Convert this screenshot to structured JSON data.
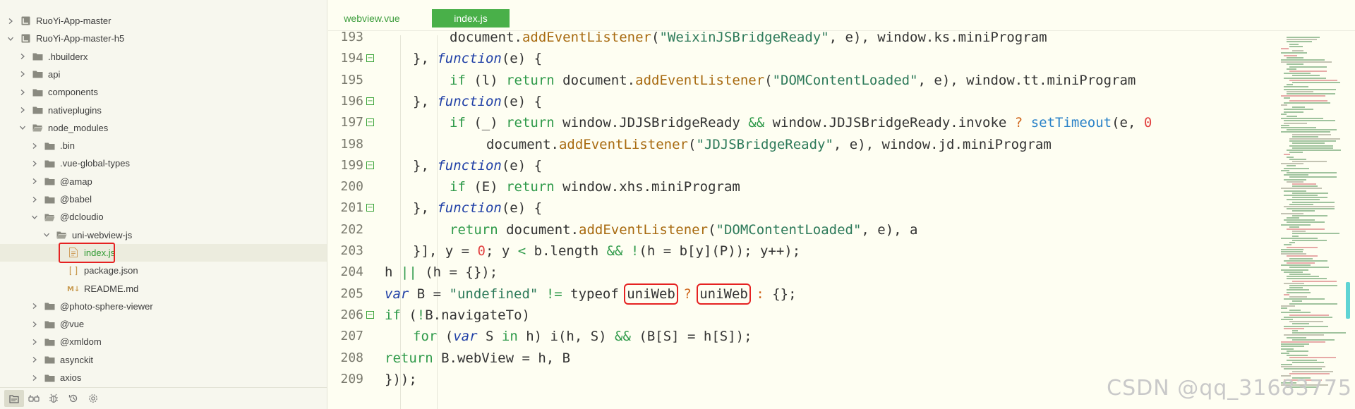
{
  "explorer": {
    "items": [
      {
        "label": "RuoYi-App-master",
        "depth": 0,
        "expanded": false,
        "type": "project"
      },
      {
        "label": "RuoYi-App-master-h5",
        "depth": 0,
        "expanded": true,
        "type": "project"
      },
      {
        "label": ".hbuilderx",
        "depth": 1,
        "expanded": false,
        "type": "folder"
      },
      {
        "label": "api",
        "depth": 1,
        "expanded": false,
        "type": "folder"
      },
      {
        "label": "components",
        "depth": 1,
        "expanded": false,
        "type": "folder"
      },
      {
        "label": "nativeplugins",
        "depth": 1,
        "expanded": false,
        "type": "folder"
      },
      {
        "label": "node_modules",
        "depth": 1,
        "expanded": true,
        "type": "folder"
      },
      {
        "label": ".bin",
        "depth": 2,
        "expanded": false,
        "type": "folder"
      },
      {
        "label": ".vue-global-types",
        "depth": 2,
        "expanded": false,
        "type": "folder"
      },
      {
        "label": "@amap",
        "depth": 2,
        "expanded": false,
        "type": "folder"
      },
      {
        "label": "@babel",
        "depth": 2,
        "expanded": false,
        "type": "folder"
      },
      {
        "label": "@dcloudio",
        "depth": 2,
        "expanded": true,
        "type": "folder"
      },
      {
        "label": "uni-webview-js",
        "depth": 3,
        "expanded": true,
        "type": "folder"
      },
      {
        "label": "index.js",
        "depth": 4,
        "type": "js-file",
        "selected": true
      },
      {
        "label": "package.json",
        "depth": 4,
        "type": "json-file"
      },
      {
        "label": "README.md",
        "depth": 4,
        "type": "md-file"
      },
      {
        "label": "@photo-sphere-viewer",
        "depth": 2,
        "expanded": false,
        "type": "folder"
      },
      {
        "label": "@vue",
        "depth": 2,
        "expanded": false,
        "type": "folder"
      },
      {
        "label": "@xmldom",
        "depth": 2,
        "expanded": false,
        "type": "folder"
      },
      {
        "label": "asynckit",
        "depth": 2,
        "expanded": false,
        "type": "folder"
      },
      {
        "label": "axios",
        "depth": 2,
        "expanded": false,
        "type": "folder"
      }
    ]
  },
  "toolbar": {
    "icons": [
      "project-manager-icon",
      "plugin-icon",
      "bug-icon",
      "history-icon",
      "settings-icon"
    ]
  },
  "tabs": [
    {
      "label": "webview.vue",
      "active": false
    },
    {
      "label": "index.js",
      "active": true
    }
  ],
  "code": {
    "lines": [
      {
        "num": "193",
        "fold": false,
        "indent": 2
      },
      {
        "num": "194",
        "fold": true,
        "indent": 1
      },
      {
        "num": "195",
        "fold": false,
        "indent": 2
      },
      {
        "num": "196",
        "fold": true,
        "indent": 1
      },
      {
        "num": "197",
        "fold": true,
        "indent": 2
      },
      {
        "num": "198",
        "fold": false,
        "indent": 3
      },
      {
        "num": "199",
        "fold": true,
        "indent": 1
      },
      {
        "num": "200",
        "fold": false,
        "indent": 2
      },
      {
        "num": "201",
        "fold": true,
        "indent": 1
      },
      {
        "num": "202",
        "fold": false,
        "indent": 2
      },
      {
        "num": "203",
        "fold": false,
        "indent": 1
      },
      {
        "num": "204",
        "fold": false,
        "indent": 0
      },
      {
        "num": "205",
        "fold": false,
        "indent": 0
      },
      {
        "num": "206",
        "fold": true,
        "indent": 0
      },
      {
        "num": "207",
        "fold": false,
        "indent": 1
      },
      {
        "num": "208",
        "fold": false,
        "indent": 0
      },
      {
        "num": "209",
        "fold": false,
        "indent": 0
      }
    ],
    "tokens": {
      "l193": [
        "document.",
        "addEventListener",
        "(",
        "\"WeixinJSBridgeReady\"",
        ", e), window.ks.miniProgram"
      ],
      "l194": [
        "}, ",
        "function",
        "(e) {"
      ],
      "l195": [
        "if",
        " (l) ",
        "return",
        " document.",
        "addEventListener",
        "(",
        "\"DOMContentLoaded\"",
        ", e), window.tt.miniProgram"
      ],
      "l196": [
        "}, ",
        "function",
        "(e) {"
      ],
      "l197": [
        "if",
        " (_) ",
        "return",
        " window.JDJSBridgeReady ",
        "&&",
        " window.JDJSBridgeReady.invoke ",
        "?",
        " ",
        "setTimeout",
        "(e, ",
        "0"
      ],
      "l198": [
        "document.",
        "addEventListener",
        "(",
        "\"JDJSBridgeReady\"",
        ", e), window.jd.miniProgram"
      ],
      "l199": [
        "}, ",
        "function",
        "(e) {"
      ],
      "l200": [
        "if",
        " (E) ",
        "return",
        " window.xhs.miniProgram"
      ],
      "l201": [
        "}, ",
        "function",
        "(e) {"
      ],
      "l202": [
        "return",
        " document.",
        "addEventListener",
        "(",
        "\"DOMContentLoaded\"",
        ", e), a"
      ],
      "l203": [
        "}], y = ",
        "0",
        "; y ",
        "<",
        " b.length ",
        "&&",
        " ",
        "!",
        "(h = b[y](P)); y++);"
      ],
      "l204": [
        "h ",
        "||",
        " (h = {});"
      ],
      "l205": [
        "var",
        " B = ",
        "\"undefined\"",
        " ",
        "!=",
        " typeof ",
        "uniWeb",
        " ",
        "?",
        " ",
        "uniWeb",
        " ",
        ":",
        " {};"
      ],
      "l206": [
        "if",
        " (",
        "!",
        "B.navigateTo)"
      ],
      "l207": [
        "for",
        " (",
        "var",
        " S ",
        "in",
        " h) i(h, S) ",
        "&&",
        " (B[S] = h[S]);"
      ],
      "l208": [
        "return",
        " B.webView = h, B"
      ],
      "l209": [
        "}));"
      ]
    }
  },
  "watermark": "CSDN @qq_31683775"
}
